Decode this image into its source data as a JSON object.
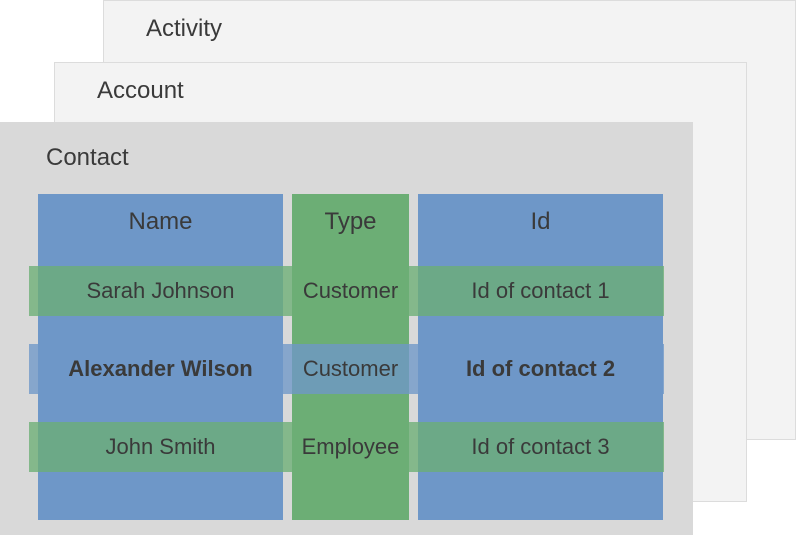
{
  "panels": {
    "activity": {
      "title": "Activity"
    },
    "account": {
      "title": "Account"
    },
    "contact": {
      "title": "Contact"
    }
  },
  "chart_data": {
    "type": "table",
    "title": "Contact",
    "columns": [
      "Name",
      "Type",
      "Id"
    ],
    "rows": [
      {
        "name": "Sarah Johnson",
        "type": "Customer",
        "id": "Id of contact 1",
        "highlight": false
      },
      {
        "name": "Alexander Wilson",
        "type": "Customer",
        "id": "Id of contact 2",
        "highlight": true
      },
      {
        "name": "John Smith",
        "type": "Employee",
        "id": "Id of contact 3",
        "highlight": false
      }
    ],
    "column_colors": {
      "Name": "#6e97c8",
      "Type": "#6cae75",
      "Id": "#6e97c8"
    }
  }
}
